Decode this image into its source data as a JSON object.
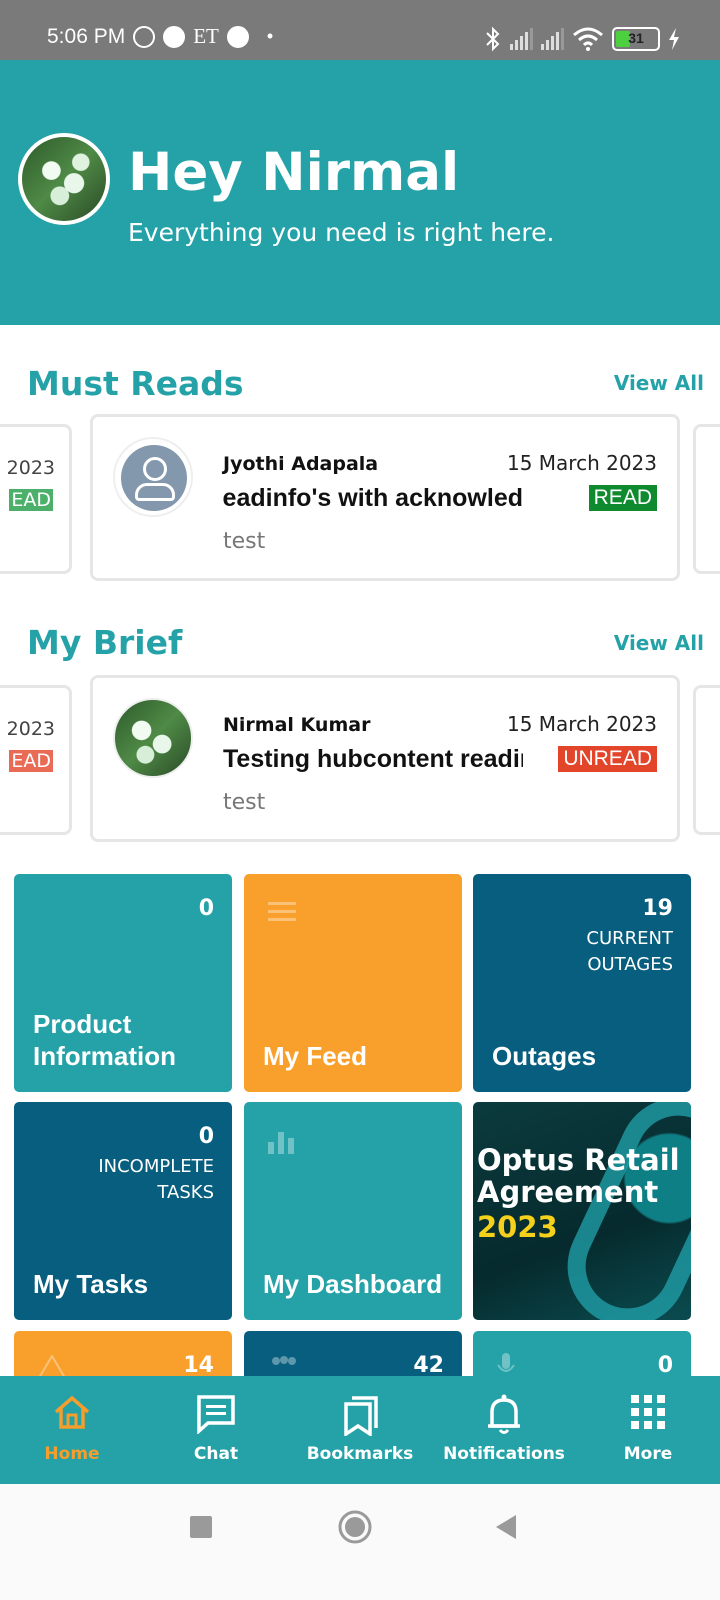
{
  "status_bar": {
    "time": "5:06 PM",
    "et_label": "ET",
    "battery": "31"
  },
  "header": {
    "greeting": "Hey Nirmal",
    "subtitle": "Everything you need is right here."
  },
  "must_reads": {
    "title": "Must Reads",
    "view_all": "View All",
    "peek_left": {
      "date": "2023",
      "status": "EAD"
    },
    "card": {
      "author": "Jyothi Adapala",
      "date": "15 March 2023",
      "title": "readinfo's with acknowled",
      "status": "READ",
      "description": "test"
    }
  },
  "my_brief": {
    "title": "My Brief",
    "view_all": "View All",
    "peek_left": {
      "date": "2023",
      "status": "EAD"
    },
    "card": {
      "author": "Nirmal Kumar",
      "date": "15 March 2023",
      "title": "Testing hubcontent readinfo",
      "status": "UNREAD",
      "description": "test"
    }
  },
  "tiles": {
    "product_information": {
      "count": "0",
      "label": "Product Information"
    },
    "my_feed": {
      "label": "My Feed"
    },
    "outages": {
      "count": "19",
      "sub": "CURRENT OUTAGES",
      "label": "Outages"
    },
    "my_tasks": {
      "count": "0",
      "sub": "INCOMPLETE TASKS",
      "label": "My Tasks"
    },
    "my_dashboard": {
      "label": "My Dashboard"
    },
    "promo": {
      "title": "Optus Retail Agreement",
      "year": "2023"
    },
    "row3_left": {
      "count": "14"
    },
    "row3_mid": {
      "count": "42"
    },
    "row3_right": {
      "count": "0"
    }
  },
  "bottom_nav": {
    "home": "Home",
    "chat": "Chat",
    "bookmarks": "Bookmarks",
    "notifications": "Notifications",
    "more": "More"
  },
  "colors": {
    "brand_teal": "#24a2a8",
    "orange": "#f9a02c",
    "navy": "#075e7e",
    "read_green": "#108a2f",
    "unread_red": "#e3452b",
    "active_nav": "#f59e2b"
  }
}
